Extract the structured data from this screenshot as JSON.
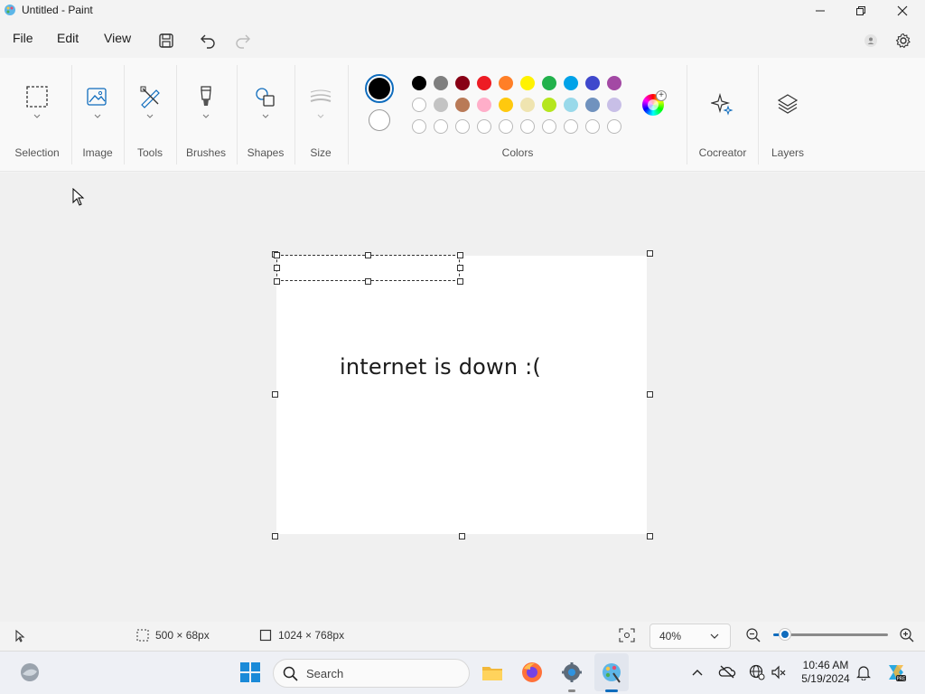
{
  "window": {
    "title": "Untitled - Paint"
  },
  "menu": {
    "file": "File",
    "edit": "Edit",
    "view": "View"
  },
  "ribbon": {
    "groups": {
      "selection": "Selection",
      "image": "Image",
      "tools": "Tools",
      "brushes": "Brushes",
      "shapes": "Shapes",
      "size": "Size",
      "colors": "Colors",
      "cocreator": "Cocreator",
      "layers": "Layers"
    },
    "primary_color": "#000000",
    "secondary_color": "#ffffff",
    "palette_row1": [
      "#000000",
      "#7f7f7f",
      "#880015",
      "#ed1c24",
      "#ff7f27",
      "#fff200",
      "#22b14c",
      "#00a2e8",
      "#3f48cc",
      "#a349a4"
    ],
    "palette_row2": [
      "#ffffff",
      "#c3c3c3",
      "#b97a57",
      "#ffaec9",
      "#ffc90e",
      "#efe4b0",
      "#b5e61d",
      "#99d9ea",
      "#7092be",
      "#c8bfe7"
    ],
    "palette_row3_empty": 10
  },
  "canvas": {
    "text": "internet is down :("
  },
  "status": {
    "selection_size": "500 × 68px",
    "canvas_size": "1024 × 768px",
    "zoom": "40%",
    "zoom_fraction": 0.1
  },
  "taskbar": {
    "search_placeholder": "Search",
    "time": "10:46 AM",
    "date": "5/19/2024"
  }
}
